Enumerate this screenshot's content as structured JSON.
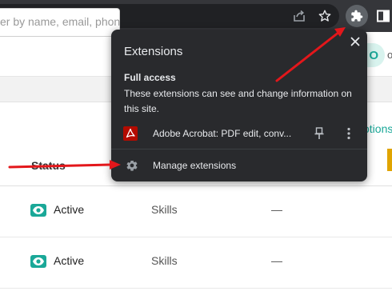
{
  "search": {
    "placeholder": "er by name, email, phon"
  },
  "badge": {
    "text": "O",
    "side": "o"
  },
  "options_link": "otions",
  "table": {
    "status_header": "Status",
    "rows": [
      {
        "status": "Active",
        "type": "Skills",
        "value": "—"
      },
      {
        "status": "Active",
        "type": "Skills",
        "value": "—"
      }
    ]
  },
  "popup": {
    "title": "Extensions",
    "section_heading": "Full access",
    "section_description": "These extensions can see and change information on this site.",
    "extension_name": "Adobe Acrobat: PDF edit, conv...",
    "manage_label": "Manage extensions"
  },
  "colors": {
    "accent": "#1aa898",
    "arrow": "#e3171b",
    "popup_bg": "#292a2d",
    "toolbar_bg": "#35363a"
  }
}
